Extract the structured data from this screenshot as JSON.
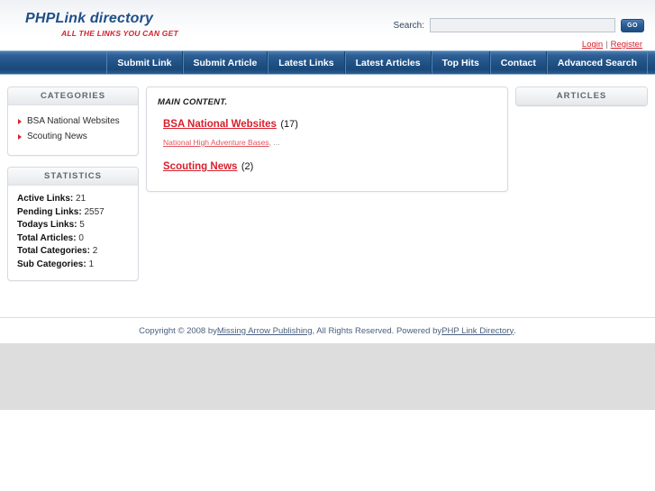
{
  "site": {
    "logo_main": "PHPLink directory",
    "logo_tagline": "ALL THE LINKS YOU CAN GET"
  },
  "search": {
    "label": "Search:",
    "value": "",
    "placeholder": "",
    "button_label": "GO"
  },
  "account": {
    "login_label": "Login",
    "separator": "|",
    "register_label": "Register"
  },
  "nav": {
    "items": [
      {
        "label": "Submit Link"
      },
      {
        "label": "Submit Article"
      },
      {
        "label": "Latest Links"
      },
      {
        "label": "Latest Articles"
      },
      {
        "label": "Top Hits"
      },
      {
        "label": "Contact"
      },
      {
        "label": "Advanced Search"
      }
    ]
  },
  "sidebar_left": {
    "categories_panel": {
      "title": "CATEGORIES",
      "items": [
        {
          "label": "BSA National Websites"
        },
        {
          "label": "Scouting News"
        }
      ]
    },
    "statistics_panel": {
      "title": "STATISTICS",
      "items": [
        {
          "label": "Active Links:",
          "value": "21"
        },
        {
          "label": "Pending Links:",
          "value": "2557"
        },
        {
          "label": "Todays Links:",
          "value": "5"
        },
        {
          "label": "Total Articles:",
          "value": "0"
        },
        {
          "label": "Total Categories:",
          "value": "2"
        },
        {
          "label": "Sub Categories:",
          "value": "1"
        }
      ]
    }
  },
  "main": {
    "title": "MAIN CONTENT.",
    "categories": [
      {
        "name": "BSA National Websites",
        "count": "(17)",
        "sub_label": "National High Adventure Bases",
        "sub_suffix": ", ..."
      },
      {
        "name": "Scouting News",
        "count": "(2)",
        "sub_label": "",
        "sub_suffix": ""
      }
    ]
  },
  "sidebar_right": {
    "articles_panel": {
      "title": "ARTICLES"
    }
  },
  "footer": {
    "prefix": "Copyright © 2008 by ",
    "publisher": "Missing Arrow Publishing",
    "middle": ", All Rights Reserved. Powered by ",
    "engine": "PHP Link Directory",
    "suffix": "."
  },
  "colors": {
    "brand_blue": "#1f4e87",
    "brand_red": "#d8202c",
    "nav_blue": "#1f5186",
    "footer_link": "#4a5f7d",
    "gray_band": "#dddddd"
  }
}
